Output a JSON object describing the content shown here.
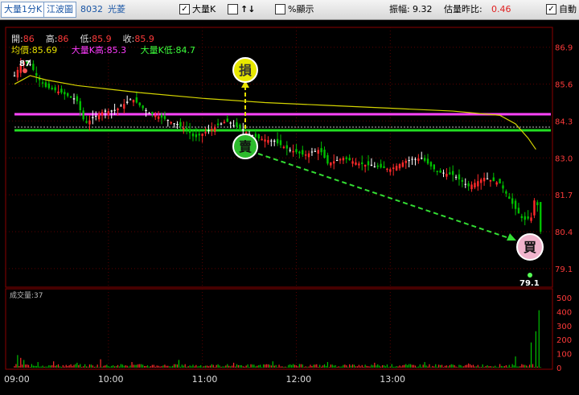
{
  "toolbar": {
    "interval_tab": "大量1分K",
    "broker_tab": "江波圖",
    "stock_code": "8032",
    "stock_name": "光菱",
    "bigk_label": "大量K",
    "arrows_label": "↑↓",
    "pct_label": "%顯示",
    "amplitude_label": "振幅:",
    "amplitude_value": "9.32",
    "estimate_label": "估量昨比:",
    "estimate_value": "0.46",
    "auto_label": "自動"
  },
  "ohlc": {
    "open_label": "開:",
    "open": "86",
    "high_label": "高:",
    "high": "86",
    "low_label": "低:",
    "low": "85.9",
    "close_label": "收:",
    "close": "85.9"
  },
  "lines": {
    "avg_label": "均價:",
    "avg": "85.69",
    "bighigh_label": "大量K高:",
    "bighigh": "85.3",
    "biglow_label": "大量K低:",
    "biglow": "84.7"
  },
  "markers": {
    "stop": "損",
    "sell": "賣",
    "buy": "買",
    "high_label": "87",
    "low_label": "79.1"
  },
  "volume_label": "成交量:37",
  "colors": {
    "up": "#ff2a2a",
    "down": "#00c000",
    "flat": "#ffffff",
    "avg": "#d4d400",
    "bighigh": "#ff44ff",
    "biglow": "#22dd22",
    "arrow": "#e6e000",
    "arrow2": "#33dd33"
  },
  "chart_data": {
    "type": "candlestick",
    "price_axis": [
      "86.9",
      "85.6",
      "84.3",
      "83.0",
      "81.7",
      "80.4",
      "79.1"
    ],
    "volume_axis": [
      "500",
      "400",
      "300",
      "200",
      "100",
      "0"
    ],
    "time_axis": [
      "09:00",
      "10:00",
      "11:00",
      "12:00",
      "13:00"
    ],
    "ylim": [
      78.5,
      87.6
    ],
    "volume_ylim": [
      0,
      500
    ],
    "avg_price": 85.69,
    "big_k_high": 85.3,
    "big_k_low": 84.7,
    "day_high": 87,
    "day_low": 79.1,
    "price_path": [
      [
        0,
        85.9
      ],
      [
        5,
        86.4
      ],
      [
        10,
        86.3
      ],
      [
        15,
        85.8
      ],
      [
        20,
        85.5
      ],
      [
        30,
        85.3
      ],
      [
        40,
        85.0
      ],
      [
        45,
        84.2
      ],
      [
        55,
        84.6
      ],
      [
        65,
        84.7
      ],
      [
        75,
        85.1
      ],
      [
        85,
        84.6
      ],
      [
        95,
        84.4
      ],
      [
        110,
        84.0
      ],
      [
        115,
        83.7
      ],
      [
        125,
        84.0
      ],
      [
        135,
        84.3
      ],
      [
        145,
        84.0
      ],
      [
        155,
        83.7
      ],
      [
        165,
        83.6
      ],
      [
        175,
        83.3
      ],
      [
        185,
        83.1
      ],
      [
        195,
        83.3
      ],
      [
        200,
        82.8
      ],
      [
        210,
        83.0
      ],
      [
        220,
        82.8
      ],
      [
        230,
        82.7
      ],
      [
        240,
        82.6
      ],
      [
        250,
        82.9
      ],
      [
        260,
        83.0
      ],
      [
        270,
        82.5
      ],
      [
        280,
        82.4
      ],
      [
        290,
        82.0
      ],
      [
        300,
        82.3
      ],
      [
        310,
        82.1
      ],
      [
        320,
        81.2
      ],
      [
        325,
        80.8
      ],
      [
        330,
        80.9
      ],
      [
        333,
        81.8
      ],
      [
        336,
        80.4
      ]
    ],
    "avg_path": [
      [
        0,
        85.6
      ],
      [
        10,
        85.9
      ],
      [
        20,
        85.75
      ],
      [
        40,
        85.55
      ],
      [
        80,
        85.3
      ],
      [
        120,
        85.1
      ],
      [
        160,
        84.95
      ],
      [
        200,
        84.85
      ],
      [
        240,
        84.75
      ],
      [
        280,
        84.65
      ],
      [
        310,
        84.5
      ],
      [
        320,
        84.2
      ],
      [
        328,
        83.7
      ],
      [
        333,
        83.3
      ]
    ],
    "volume_spikes": [
      [
        2,
        90
      ],
      [
        4,
        70
      ],
      [
        6,
        55
      ],
      [
        15,
        40
      ],
      [
        25,
        45
      ],
      [
        40,
        35
      ],
      [
        55,
        60
      ],
      [
        75,
        40
      ],
      [
        105,
        55
      ],
      [
        140,
        35
      ],
      [
        165,
        45
      ],
      [
        200,
        40
      ],
      [
        230,
        35
      ],
      [
        262,
        40
      ],
      [
        290,
        30
      ],
      [
        320,
        80
      ],
      [
        330,
        180
      ],
      [
        333,
        260
      ],
      [
        335,
        410
      ]
    ]
  }
}
